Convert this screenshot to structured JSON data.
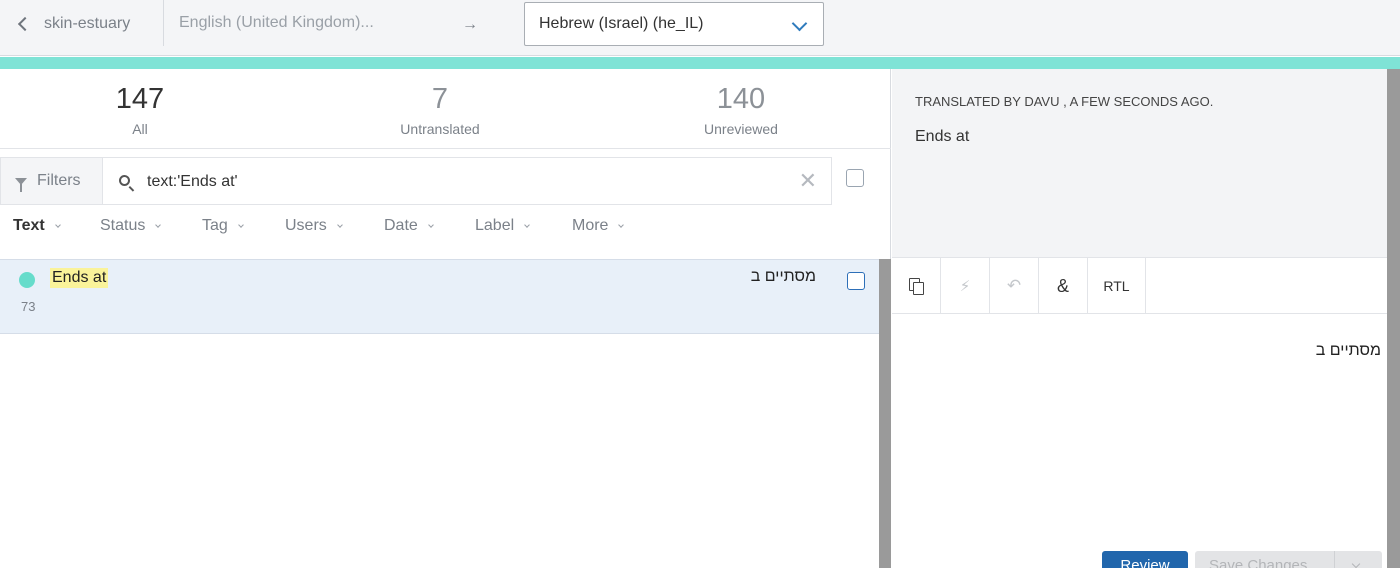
{
  "header": {
    "project": "skin-estuary",
    "source_language": "English (United Kingdom)...",
    "arrow": "→",
    "target_language": "Hebrew (Israel) (he_IL)"
  },
  "colors": {
    "progress": "#7fe3d6",
    "accent": "#2166ac",
    "status_dot": "#66dccb",
    "highlight": "#faf39a"
  },
  "stats": [
    {
      "count": "147",
      "label": "All"
    },
    {
      "count": "7",
      "label": "Untranslated"
    },
    {
      "count": "140",
      "label": "Unreviewed"
    }
  ],
  "filters": {
    "label": "Filters",
    "search_value": "text:'Ends at'",
    "clear_glyph": "✕"
  },
  "sort_columns": [
    "Text",
    "Status",
    "Tag",
    "Users",
    "Date",
    "Label",
    "More"
  ],
  "list": {
    "items": [
      {
        "source": "Ends at",
        "id": "73",
        "translation": "מסתיים ב"
      }
    ]
  },
  "detail": {
    "translated_by": "TRANSLATED BY DAVU , A FEW SECONDS AGO.",
    "source_text": "Ends at",
    "toolbar": {
      "copy_icon": "copy-icon",
      "machine_icon": "bolt-icon",
      "undo_icon": "undo-icon",
      "special_char_icon": "special-character-icon",
      "rtl_label": "RTL"
    },
    "editor_value": "מסתיים ב",
    "review_label": "Review",
    "save_label": "Save Changes"
  }
}
